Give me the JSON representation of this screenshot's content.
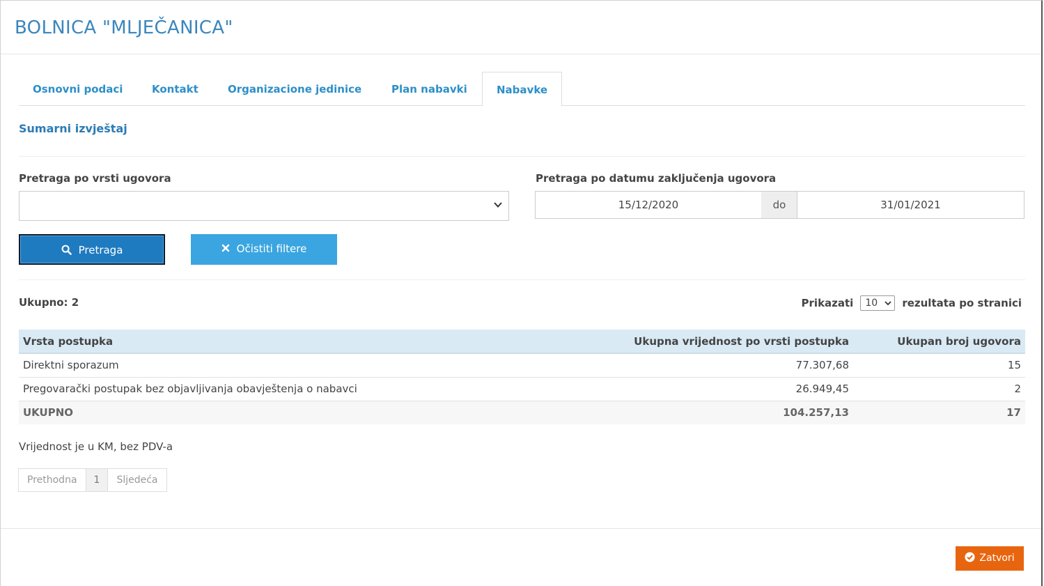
{
  "header": {
    "title": "BOLNICA \"MLJEČANICA\""
  },
  "tabs": [
    {
      "label": "Osnovni podaci",
      "active": false
    },
    {
      "label": "Kontakt",
      "active": false
    },
    {
      "label": "Organizacione jedinice",
      "active": false
    },
    {
      "label": "Plan nabavki",
      "active": false
    },
    {
      "label": "Nabavke",
      "active": true
    }
  ],
  "section": {
    "title": "Sumarni izvještaj"
  },
  "filters": {
    "type_label": "Pretraga po vrsti ugovora",
    "type_value": "",
    "date_label": "Pretraga po datumu zaključenja ugovora",
    "date_from": "15/12/2020",
    "date_sep": "do",
    "date_to": "31/01/2021"
  },
  "buttons": {
    "search": "Pretraga",
    "clear": "Očistiti filtere",
    "close": "Zatvori"
  },
  "results": {
    "total_label": "Ukupno: 2",
    "show_label": "Prikazati",
    "page_size": "10",
    "per_page_label": "rezultata po stranici"
  },
  "table": {
    "headers": [
      "Vrsta postupka",
      "Ukupna vrijednost po vrsti postupka",
      "Ukupan broj ugovora"
    ],
    "rows": [
      [
        "Direktni sporazum",
        "77.307,68",
        "15"
      ],
      [
        "Pregovarački postupak bez objavljivanja obavještenja o nabavci",
        "26.949,45",
        "2"
      ]
    ],
    "total": [
      "UKUPNO",
      "104.257,13",
      "17"
    ]
  },
  "note": "Vrijednost je u KM, bez PDV-a",
  "pagination": {
    "prev": "Prethodna",
    "page": "1",
    "next": "Sljedeća"
  },
  "colors": {
    "accent": "#2d8fc8",
    "primary_button": "#1f7bc0",
    "secondary_button": "#3aa5e0",
    "close_button": "#e8650f",
    "table_header": "#d9eaf5"
  },
  "icons": {
    "search": "search-icon",
    "clear": "times-icon",
    "close": "check-circle-icon",
    "select": "chevron-down-icon"
  }
}
